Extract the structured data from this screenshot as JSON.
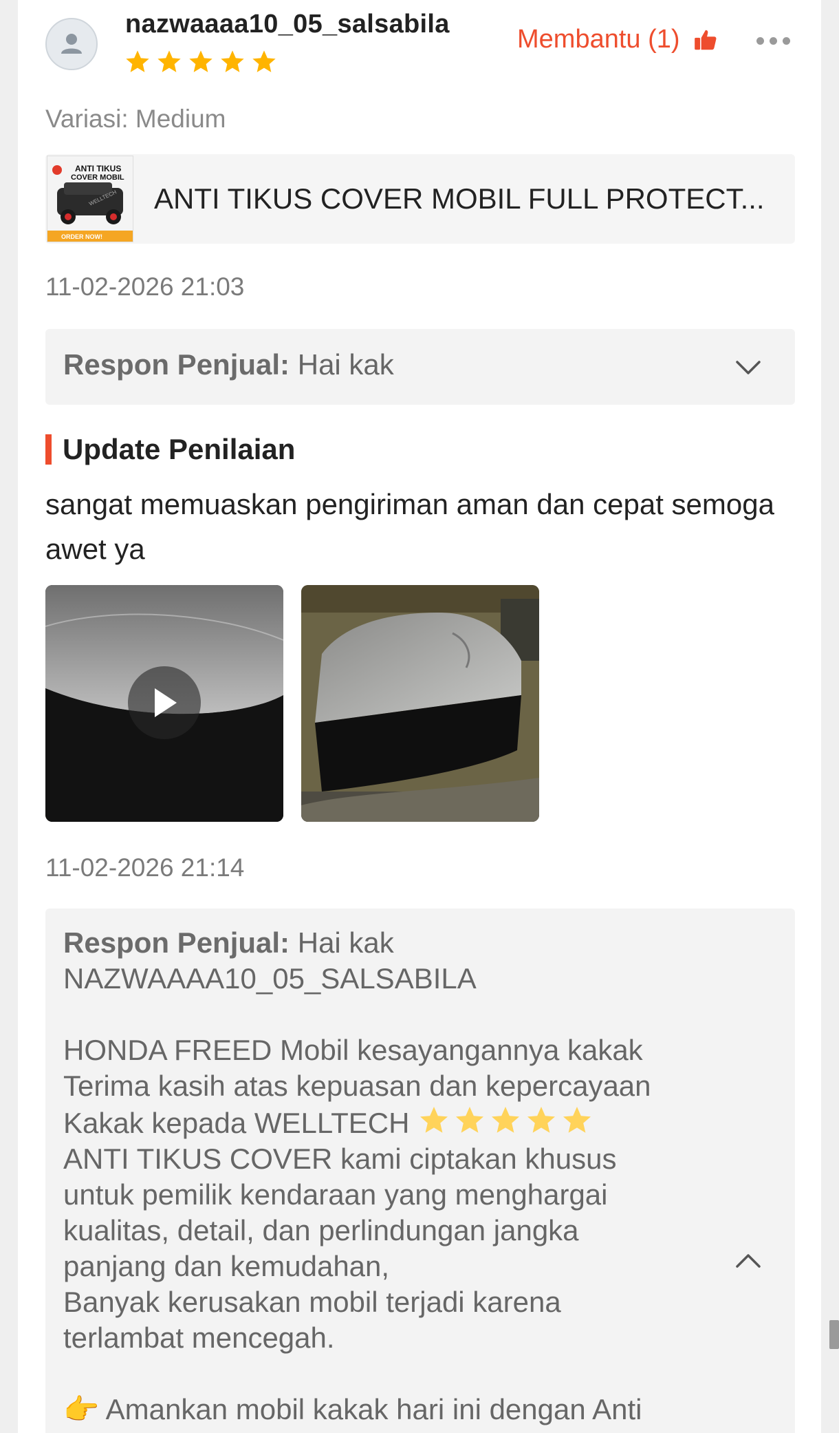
{
  "review": {
    "username": "nazwaaaa10_05_salsabila",
    "rating": 5,
    "helpful_label": "Membantu (1)",
    "variation": "Variasi: Medium",
    "product_title": "ANTI TIKUS COVER MOBIL FULL PROTECT...",
    "product_thumb": {
      "line1": "ANTI TIKUS",
      "line2": "COVER MOBIL",
      "badge": "ORDER NOW!",
      "watermark": "WELLTECH"
    },
    "timestamp_1": "11-02-2026 21:03",
    "seller_reply_1": {
      "label": "Respon Penjual:",
      "text": "Hai kak"
    },
    "update_title": "Update Penilaian",
    "update_text": "sangat memuaskan pengiriman aman dan cepat semoga awet ya",
    "timestamp_2": "11-02-2026 21:14",
    "seller_reply_2": {
      "label": "Respon Penjual:",
      "line1": "Hai kak",
      "line2": "NAZWAAAA10_05_SALSABILA",
      "line3": "HONDA FREED Mobil kesayangannya kakak",
      "line4": "Terima kasih atas kepuasan dan kepercayaan",
      "line5": "Kakak kepada WELLTECH",
      "line6": "ANTI TIKUS COVER kami ciptakan khusus",
      "line7": "untuk pemilik kendaraan yang menghargai",
      "line8": "kualitas, detail, dan perlindungan jangka",
      "line9": "panjang dan kemudahan,",
      "line10": "Banyak kerusakan mobil terjadi karena",
      "line11": "terlambat mencegah.",
      "line12": "Amankan mobil kakak hari ini dengan Anti",
      "line12_emoji": "👉"
    }
  },
  "colors": {
    "accent": "#ee4d2d",
    "star": "#ffb400",
    "reply_bg": "#f3f3f3"
  }
}
